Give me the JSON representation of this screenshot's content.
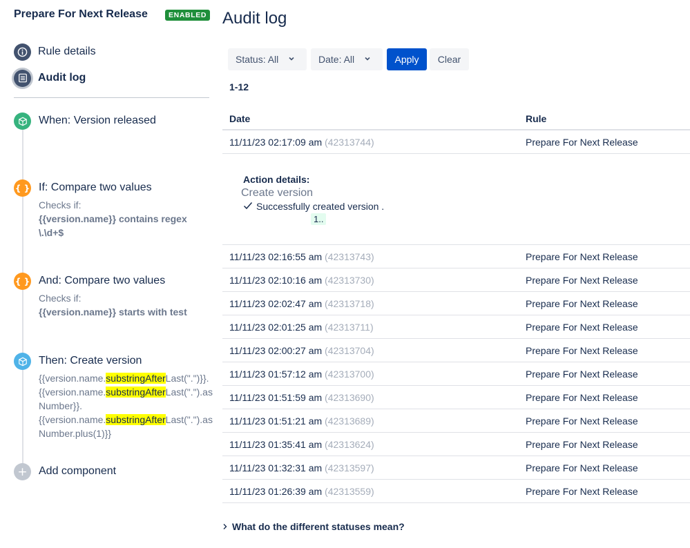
{
  "sidebar": {
    "rule_title": "Prepare For Next Release",
    "status_badge": "ENABLED",
    "nav": [
      {
        "label": "Rule details",
        "icon": "info-icon"
      },
      {
        "label": "Audit log",
        "icon": "list-icon"
      }
    ],
    "components": [
      {
        "type": "trigger",
        "title": "When: Version released",
        "icon": "package-icon"
      },
      {
        "type": "condition",
        "title": "If: Compare two values",
        "checks_label": "Checks if:",
        "condition_text": "{{version.name}} contains regex \\.\\d+$",
        "icon": "braces-icon"
      },
      {
        "type": "condition",
        "title": "And: Compare two values",
        "checks_label": "Checks if:",
        "condition_text": "{{version.name}} starts with test",
        "icon": "braces-icon"
      },
      {
        "type": "action",
        "title": "Then: Create version",
        "icon": "package-icon",
        "expr": {
          "l1_pre": "{{version.name.",
          "l1_hl": "substringAfter",
          "l1_post": "Last(\".\")}}.",
          "l2_pre": "{{version.name.",
          "l2_hl": "substringAfter",
          "l2_post": "Last(\".\").as",
          "l3": "Number}}.",
          "l4_pre": "{{version.name.",
          "l4_hl": "substringAfter",
          "l4_post": "Last(\".\").as",
          "l5": "Number.plus(1)}}"
        }
      }
    ],
    "add_component": "Add component"
  },
  "main": {
    "title": "Audit log",
    "filters": {
      "status": "Status: All",
      "date": "Date: All",
      "apply": "Apply",
      "clear": "Clear"
    },
    "range": "1-12",
    "columns": {
      "date": "Date",
      "rule": "Rule"
    },
    "rows": [
      {
        "date": "11/11/23 02:17:09 am",
        "id": "(42313744)",
        "rule": "Prepare For Next Release"
      },
      {
        "date": "11/11/23 02:16:55 am",
        "id": "(42313743)",
        "rule": "Prepare For Next Release"
      },
      {
        "date": "11/11/23 02:10:16 am",
        "id": "(42313730)",
        "rule": "Prepare For Next Release"
      },
      {
        "date": "11/11/23 02:02:47 am",
        "id": "(42313718)",
        "rule": "Prepare For Next Release"
      },
      {
        "date": "11/11/23 02:01:25 am",
        "id": "(42313711)",
        "rule": "Prepare For Next Release"
      },
      {
        "date": "11/11/23 02:00:27 am",
        "id": "(42313704)",
        "rule": "Prepare For Next Release"
      },
      {
        "date": "11/11/23 01:57:12 am",
        "id": "(42313700)",
        "rule": "Prepare For Next Release"
      },
      {
        "date": "11/11/23 01:51:59 am",
        "id": "(42313690)",
        "rule": "Prepare For Next Release"
      },
      {
        "date": "11/11/23 01:51:21 am",
        "id": "(42313689)",
        "rule": "Prepare For Next Release"
      },
      {
        "date": "11/11/23 01:35:41 am",
        "id": "(42313624)",
        "rule": "Prepare For Next Release"
      },
      {
        "date": "11/11/23 01:32:31 am",
        "id": "(42313597)",
        "rule": "Prepare For Next Release"
      },
      {
        "date": "11/11/23 01:26:39 am",
        "id": "(42313559)",
        "rule": "Prepare For Next Release"
      }
    ],
    "details": {
      "title": "Action details:",
      "action": "Create version",
      "status": "Successfully created version .",
      "version": "1.."
    },
    "statuses_link": "What do the different statuses mean?"
  },
  "colors": {
    "accent": "#0052cc",
    "enabled_badge": "#1f8f3a",
    "trigger": "#36b37e",
    "condition": "#ff991f",
    "action": "#4fb3e8",
    "highlight": "#ffff00"
  }
}
